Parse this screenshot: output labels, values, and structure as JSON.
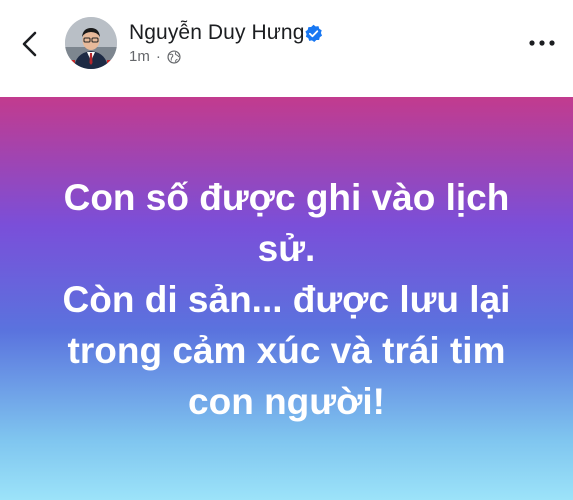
{
  "header": {
    "author_name": "Nguyễn Duy Hưng",
    "timestamp": "1m",
    "separator": "·",
    "icons": {
      "back": "chevron-left-icon",
      "verified": "verified-badge-icon",
      "audience": "globe-icon",
      "more": "more-horizontal-icon"
    },
    "colors": {
      "verified_badge": "#1877f2",
      "name_text": "#1c1e21",
      "meta_text": "#65676b"
    }
  },
  "post": {
    "lines": [
      "Con số được ghi vào lịch",
      "sử.",
      "Còn di sản... được lưu lại",
      "trong cảm xúc và trái tim",
      "con người!"
    ],
    "background_colors": [
      "#c23b8e",
      "#7a4fd9",
      "#5a73de",
      "#7fc5ef",
      "#9ce3f9"
    ],
    "text_color": "#ffffff"
  }
}
